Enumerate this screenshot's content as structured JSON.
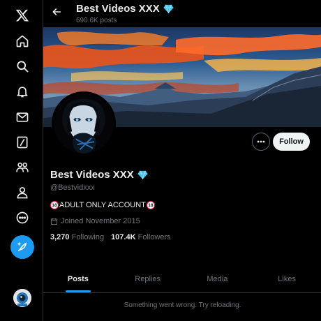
{
  "nav": {
    "items": [
      {
        "icon": "x-logo-icon"
      },
      {
        "icon": "home-icon"
      },
      {
        "icon": "search-icon"
      },
      {
        "icon": "notifications-icon"
      },
      {
        "icon": "messages-icon"
      },
      {
        "icon": "grok-icon"
      },
      {
        "icon": "communities-icon"
      },
      {
        "icon": "profile-icon"
      },
      {
        "icon": "more-icon"
      }
    ],
    "compose_icon": "feather-icon",
    "accent": "#1d9bf0"
  },
  "header": {
    "title": "Best Videos XXX",
    "post_count": "690.6K posts",
    "verified_icon": "diamond-icon"
  },
  "profile": {
    "name": "Best Videos XXX",
    "handle": "@Bestvidxxx",
    "bio_badge": "18",
    "bio_text": "ADULT ONLY ACCOUNT",
    "joined": "Joined November 2015",
    "following_count": "3,270",
    "following_label": "Following",
    "followers_count": "107.4K",
    "followers_label": "Followers",
    "follow_label": "Follow"
  },
  "tabs": [
    {
      "label": "Posts",
      "active": true
    },
    {
      "label": "Replies",
      "active": false
    },
    {
      "label": "Media",
      "active": false
    },
    {
      "label": "Likes",
      "active": false
    }
  ],
  "status": {
    "message": "Something went wrong. Try reloading."
  }
}
